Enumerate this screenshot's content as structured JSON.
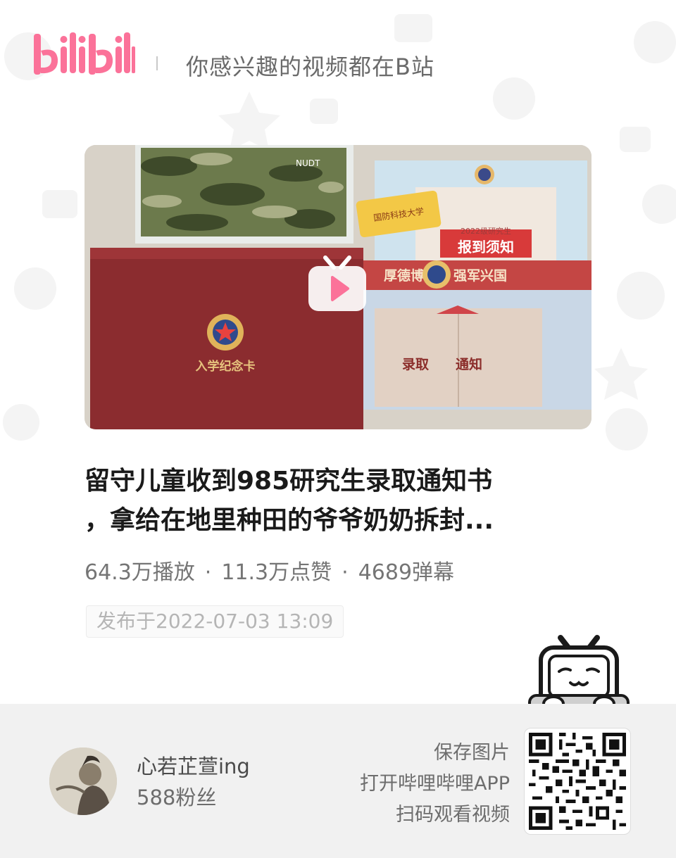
{
  "header": {
    "logo_text": "bilibili",
    "slogan": "你感兴趣的视频都在B站"
  },
  "video": {
    "title_line1": "留守儿童收到985研究生录取通知书",
    "title_line2": "，拿给在地里种田的爷爷奶奶拆封...",
    "views": "64.3万播放",
    "likes": "11.3万点赞",
    "danmaku": "4689弹幕",
    "separator": "·",
    "publish_date": "发布于2022-07-03 13:09",
    "cover_texts": {
      "mask_label": "NUDT",
      "school_tag": "国防科技大学",
      "grad_label": "2022级研究生",
      "notice": "报到须知",
      "motto_left": "厚德博学",
      "motto_right": "强军兴国",
      "card_title": "入学纪念卡",
      "admission_left": "录取",
      "admission_right": "通知"
    }
  },
  "uploader": {
    "name": "心若芷萱ing",
    "fans": "588粉丝"
  },
  "save_info": {
    "line1": "保存图片",
    "line2": "打开哔哩哔哩APP",
    "line3": "扫码观看视频"
  },
  "icons": {
    "logo": "bilibili-logo",
    "play": "tv-play-icon",
    "mascot": "bilibili-tv-mascot-icon",
    "qr": "qr-code"
  },
  "colors": {
    "brand_pink": "#FB7299",
    "footer_bg": "#F1F1F1"
  }
}
